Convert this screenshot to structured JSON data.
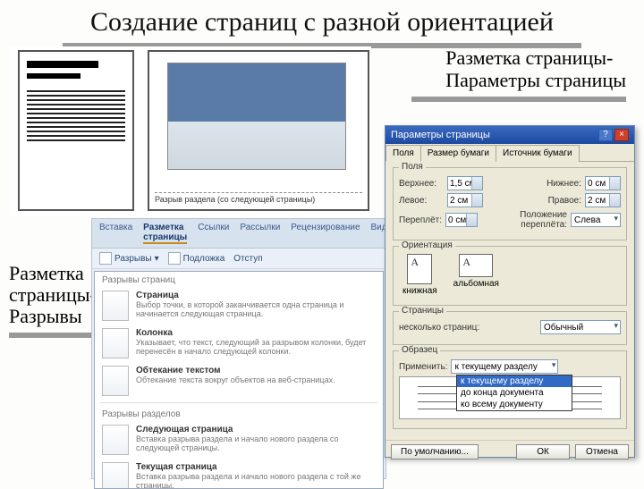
{
  "title": "Создание страниц с разной ориентацией",
  "subtitle_right": "Разметка страницы-\nПараметры страницы",
  "caption_left": "Разметка\nстраницы-\nРазрывы",
  "doc": {
    "break_label": "Разрыв раздела (со следующей страницы)"
  },
  "ribbon": {
    "tabs": [
      "Вставка",
      "Разметка страницы",
      "Ссылки",
      "Рассылки",
      "Рецензирование",
      "Вид"
    ],
    "active_tab": "Разметка страницы",
    "breaks_label": "Разрывы",
    "watermark_label": "Подложка",
    "indent_label": "Отступ",
    "panel_title": "Разрывы страниц",
    "items": [
      {
        "title": "Страница",
        "desc": "Выбор точки, в которой заканчивается одна страница и начинается следующая страница."
      },
      {
        "title": "Колонка",
        "desc": "Указывает, что текст, следующий за разрывом колонки, будет перенесён в начало следующей колонки."
      },
      {
        "title": "Обтекание текстом",
        "desc": "Обтекание текста вокруг объектов на веб-страницах."
      }
    ],
    "section_title": "Разрывы разделов",
    "section_items": [
      {
        "title": "Следующая страница",
        "desc": "Вставка разрыва раздела и начало нового раздела со следующей страницы."
      },
      {
        "title": "Текущая страница",
        "desc": "Вставка разрыва раздела и начало нового раздела с той же страницы."
      }
    ]
  },
  "dialog": {
    "title": "Параметры страницы",
    "tabs": [
      "Поля",
      "Размер бумаги",
      "Источник бумаги"
    ],
    "active_tab": "Поля",
    "margins_legend": "Поля",
    "top_label": "Верхнее:",
    "top_val": "1,5 см",
    "bottom_label": "Нижнее:",
    "bottom_val": "0 см",
    "left_label": "Левое:",
    "left_val": "2 см",
    "right_label": "Правое:",
    "right_val": "2 см",
    "gutter_label": "Переплёт:",
    "gutter_val": "0 см",
    "gutter_pos_label": "Положение переплёта:",
    "gutter_pos_val": "Слева",
    "orient_legend": "Ориентация",
    "orient_portrait": "книжная",
    "orient_landscape": "альбомная",
    "pages_legend": "Страницы",
    "multi_label": "несколько страниц:",
    "multi_val": "Обычный",
    "preview_legend": "Образец",
    "apply_label": "Применить:",
    "apply_selected": "к текущему разделу",
    "apply_options": [
      "к текущему разделу",
      "до конца документа",
      "ко всему документу"
    ],
    "default_btn": "По умолчанию...",
    "ok_btn": "ОК",
    "cancel_btn": "Отмена"
  }
}
